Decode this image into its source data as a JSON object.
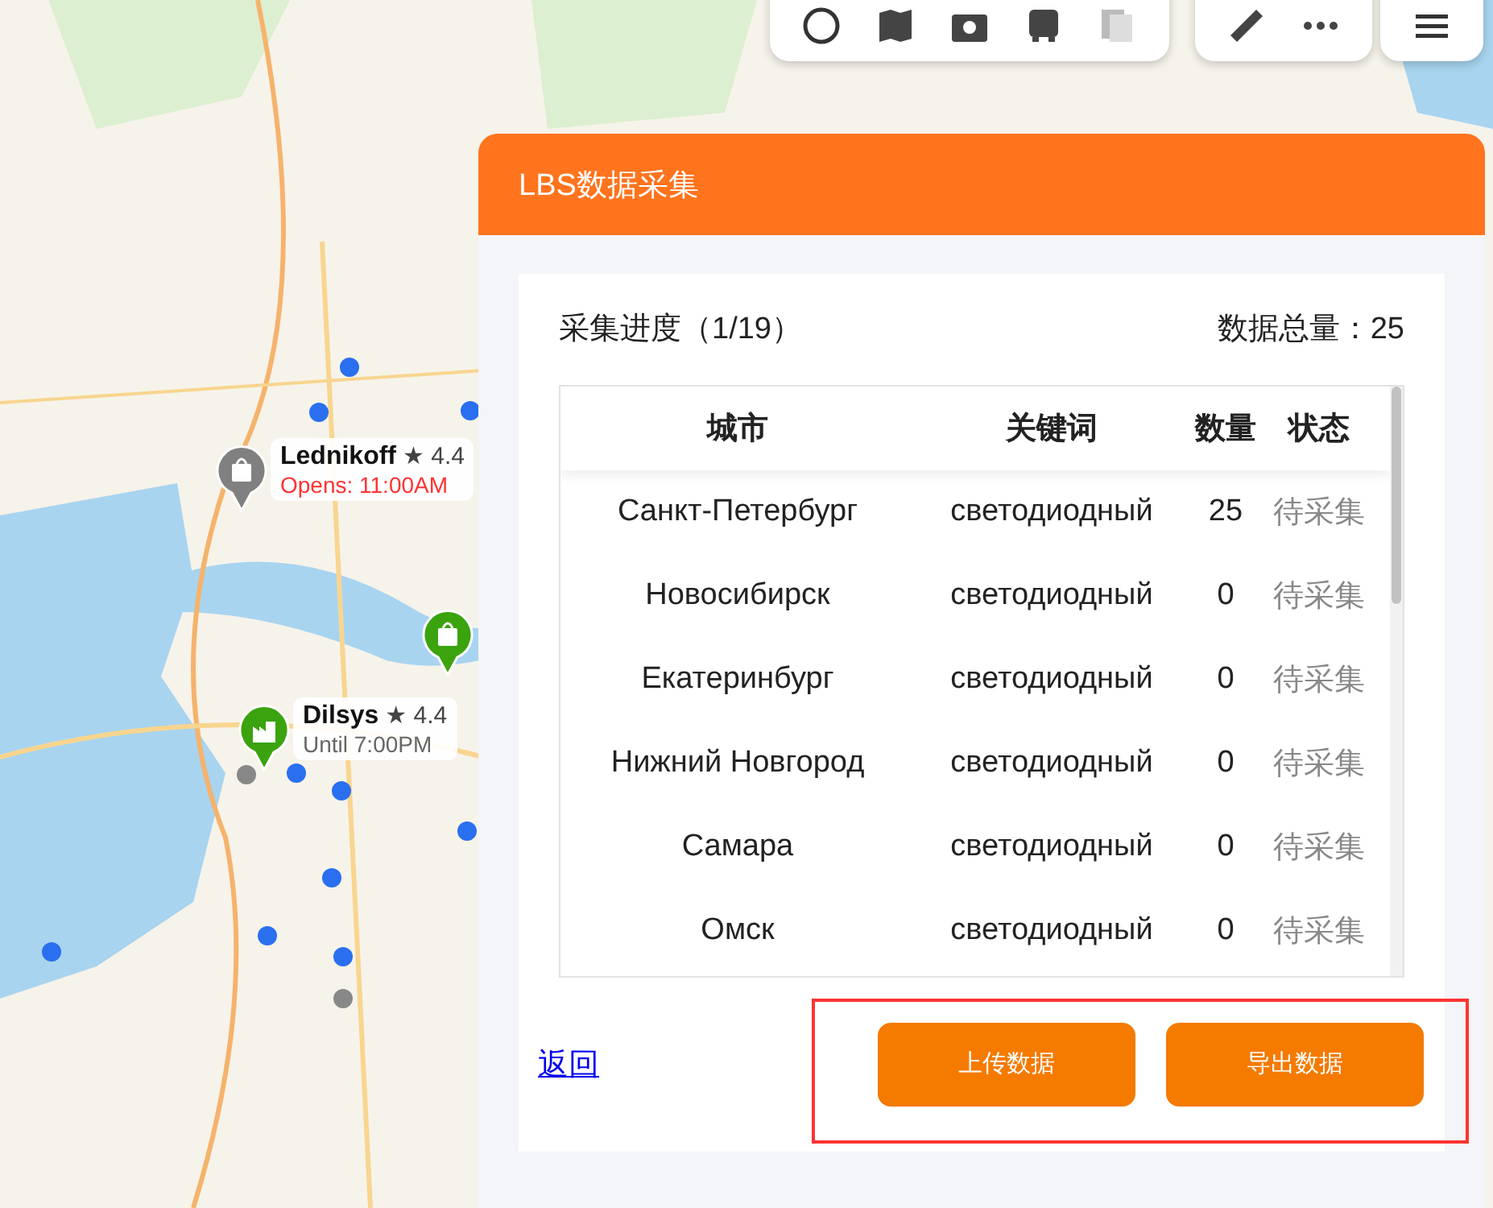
{
  "map_pins": [
    {
      "kind": "shop",
      "open": false,
      "name": "Lednikoff",
      "rating": "★ 4.4",
      "hours": "Opens: 11:00AM"
    },
    {
      "kind": "shop",
      "open": true
    },
    {
      "kind": "factory",
      "open": true,
      "name": "Dilsys",
      "rating": "★ 4.4",
      "hours": "Until 7:00PM"
    }
  ],
  "panel": {
    "title": "LBS数据采集",
    "progress": "采集进度（1/19）",
    "total": "数据总量：25",
    "table": {
      "columns": [
        "城市",
        "关键词",
        "数量",
        "状态"
      ],
      "rows": [
        {
          "city": "Санкт-Петербург",
          "keyword": "светодиодный",
          "count": "25",
          "status": "待采集"
        },
        {
          "city": "Новосибирск",
          "keyword": "светодиодный",
          "count": "0",
          "status": "待采集"
        },
        {
          "city": "Екатеринбург",
          "keyword": "светодиодный",
          "count": "0",
          "status": "待采集"
        },
        {
          "city": "Нижний Новгород",
          "keyword": "светодиодный",
          "count": "0",
          "status": "待采集"
        },
        {
          "city": "Самара",
          "keyword": "светодиодный",
          "count": "0",
          "status": "待采集"
        },
        {
          "city": "Омск",
          "keyword": "светодиодный",
          "count": "0",
          "status": "待采集"
        }
      ]
    },
    "back_link": "返回",
    "buttons": [
      "上传数据",
      "导出数据"
    ],
    "buttons_highlighted": true
  }
}
